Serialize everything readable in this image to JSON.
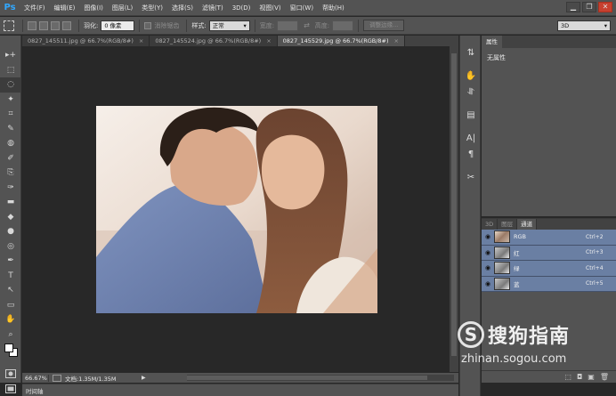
{
  "app": {
    "logo": "Ps"
  },
  "menu": [
    "文件(F)",
    "编辑(E)",
    "图像(I)",
    "图层(L)",
    "类型(Y)",
    "选择(S)",
    "滤镜(T)",
    "3D(D)",
    "视图(V)",
    "窗口(W)",
    "帮助(H)"
  ],
  "window_controls": [
    "▁",
    "❐",
    "✕"
  ],
  "options": {
    "feather_label": "羽化:",
    "feather_value": "0 像素",
    "antialias_label": "消除锯齿",
    "style_label": "样式:",
    "style_value": "正常",
    "width_label": "宽度:",
    "height_label": "高度:",
    "refine_edge": "调整边缘...",
    "workspace": "3D"
  },
  "tabs": [
    {
      "label": "0827_145511.jpg @ 66.7%(RGB/8#)",
      "close": "×",
      "active": false
    },
    {
      "label": "0827_145524.jpg @ 66.7%(RGB/8#)",
      "close": "×",
      "active": false
    },
    {
      "label": "0827_145529.jpg @ 66.7%(RGB/8#)",
      "close": "×",
      "active": true
    }
  ],
  "tools": [
    "▸+",
    "⬚",
    "◌",
    "✦",
    "⌗",
    "✎",
    "◍",
    "✐",
    "⎘",
    "✑",
    "▬",
    "◆",
    "●",
    "◎",
    "✒",
    "T",
    "↖",
    "▭",
    "✋",
    "⌕"
  ],
  "status": {
    "zoom": "66.67%",
    "doc_info": "文档:1.35M/1.35M",
    "arrow": "▶"
  },
  "timeline": {
    "label": "时间轴"
  },
  "strip_icons": [
    "⇅",
    "✋",
    "⥯",
    "▤",
    "A|",
    "¶",
    "✂"
  ],
  "properties": {
    "tab": "属性",
    "text": "无属性"
  },
  "channels": {
    "tabs": [
      "3D",
      "图层",
      "通道"
    ],
    "active_tab": "通道",
    "rows": [
      {
        "name": "RGB",
        "shortcut": "Ctrl+2"
      },
      {
        "name": "红",
        "shortcut": "Ctrl+3"
      },
      {
        "name": "绿",
        "shortcut": "Ctrl+4"
      },
      {
        "name": "蓝",
        "shortcut": "Ctrl+5"
      }
    ],
    "bottom_icons": [
      "⬚",
      "◘",
      "▣",
      "🗑"
    ]
  },
  "watermark": {
    "logo": "S",
    "text": "搜狗指南",
    "url": "zhinan.sogou.com"
  }
}
